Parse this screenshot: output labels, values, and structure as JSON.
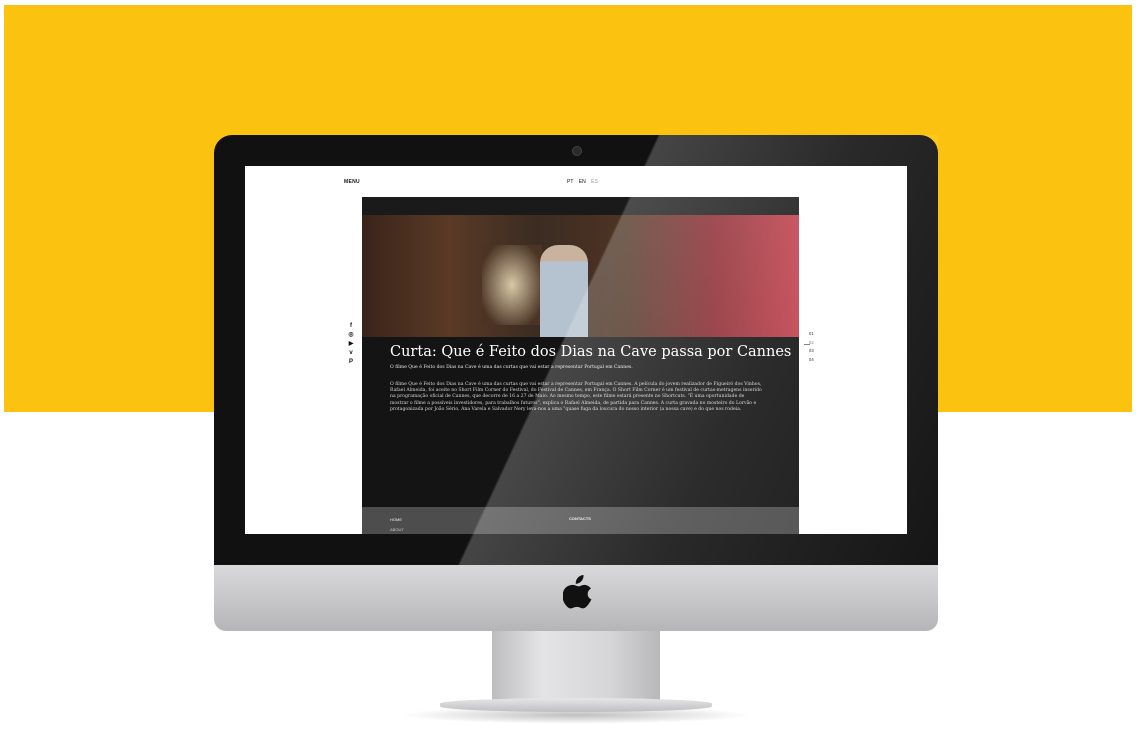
{
  "colors": {
    "background_accent": "#fbc310",
    "bezel": "#111111",
    "content_dark": "#1a1a1a",
    "footer": "#4d4d4d"
  },
  "site": {
    "menu_label": "MENU",
    "languages": [
      {
        "label": "PT"
      },
      {
        "label": "EN"
      },
      {
        "label": "ES"
      }
    ],
    "social": [
      {
        "icon": "facebook-icon",
        "glyph": "f"
      },
      {
        "icon": "instagram-icon",
        "glyph": "◎"
      },
      {
        "icon": "youtube-icon",
        "glyph": "▶"
      },
      {
        "icon": "vimeo-icon",
        "glyph": "v"
      },
      {
        "icon": "pinterest-icon",
        "glyph": "P"
      }
    ],
    "pager": [
      "01",
      "02",
      "03",
      "04"
    ],
    "pager_active_index": 1,
    "article": {
      "title": "Curta: Que é Feito dos Dias na Cave passa por Cannes",
      "lead": "O filme Que é Feito dos Dias na Cave é uma das curtas que vai estar a representar Portugal em Cannes.",
      "body": "O filme Que é Feito dos Dias na Cave é uma das curtas que vai estar a representar Portugal em Cannes. A película do jovem realizador de Figueiró dos Vinhos, Rafael Almeida, foi aceite no Short Film Corner do Festival, do Festival de Cannes, em França. O Short Film Corner é um festival de curtas-metragens inserido na programação oficial de Cannes, que decorre de 16 a 27 de Maio. Ao mesmo tempo, este filme estará presente no Shortcuts. \"É uma oportunidade de mostrar o filme a possíveis investidores, para trabalhos futuros\", explica o Rafael Almeida, de partida para Cannes. A curta gravada no mosteiro do Lorvão e protagonizada por João Sério, Ana Varela e Salvador Nery leva-nos a uma \"quase fuga da loucura do nosso interior (a nossa cave) e do que nos rodeia."
    },
    "footer": {
      "home": "HOME",
      "about": "ABOUT",
      "contacts": "CONTACTS"
    }
  }
}
